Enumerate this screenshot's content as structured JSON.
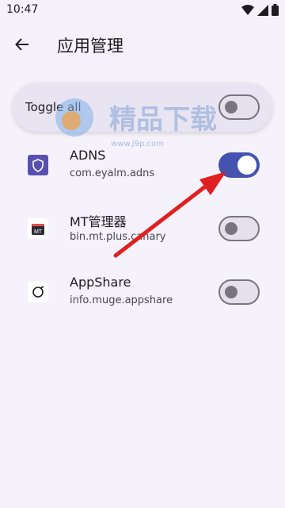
{
  "status_bar": {
    "time": "10:47"
  },
  "app_bar": {
    "title": "应用管理"
  },
  "toggle_all": {
    "label": "Toggle all",
    "enabled": false
  },
  "apps": [
    {
      "name": "ADNS",
      "package": "com.eyalm.adns",
      "enabled": true,
      "icon": "shield-icon"
    },
    {
      "name": "MT管理器",
      "package": "bin.mt.plus.canary",
      "enabled": false,
      "icon": "mt-icon"
    },
    {
      "name": "AppShare",
      "package": "info.muge.appshare",
      "enabled": false,
      "icon": "appshare-icon"
    }
  ],
  "watermark": {
    "title": "精品下载",
    "url": "www.j9p.com"
  },
  "colors": {
    "accent": "#4452b0",
    "background": "#f6f2fb",
    "arrow": "#e02020"
  }
}
